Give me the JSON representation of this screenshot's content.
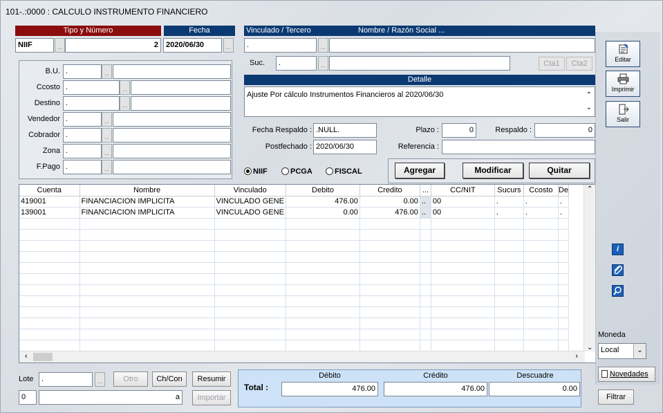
{
  "window": {
    "title": "101-.:0000 : CALCULO INSTRUMENTO FINANCIERO"
  },
  "doc": {
    "tipo_header": "Tipo y Número",
    "fecha_header": "Fecha",
    "tipo": "NIIF",
    "numero": "2",
    "fecha": "2020/06/30"
  },
  "vinculado": {
    "header_left": "Vinculado / Tercero",
    "header_right": "Nombre / Razón Social ...",
    "value": ".",
    "suc_label": "Suc.",
    "suc_value": ".",
    "cta1": "Cta1",
    "cta2": "Cta2"
  },
  "detalle": {
    "header": "Detalle",
    "text": "Ajuste Por cálculo Instrumentos Financieros al  2020/06/30"
  },
  "fields": [
    {
      "label": "B.U.",
      "value": "."
    },
    {
      "label": "Ccosto",
      "value": "."
    },
    {
      "label": "Destino",
      "value": "."
    },
    {
      "label": "Vendedor",
      "value": "."
    },
    {
      "label": "Cobrador",
      "value": "."
    },
    {
      "label": "Zona",
      "value": "."
    },
    {
      "label": "F.Pago",
      "value": "."
    }
  ],
  "respaldo": {
    "fecha_label": "Fecha Respaldo :",
    "fecha_value": ".NULL.",
    "plazo_label": "Plazo :",
    "plazo_value": "0",
    "respaldo_label": "Respaldo :",
    "respaldo_value": "0",
    "postf_label": "Postfechado :",
    "postf_value": "2020/06/30",
    "ref_label": "Referencia :",
    "ref_value": ""
  },
  "radios": [
    {
      "label": "NIIF",
      "checked": true
    },
    {
      "label": "PCGA",
      "checked": false
    },
    {
      "label": "FISCAL",
      "checked": false
    }
  ],
  "actions": {
    "agregar": "Agregar",
    "modificar": "Modificar",
    "quitar": "Quitar"
  },
  "side": {
    "editar": "Editar",
    "imprimir": "Imprimir",
    "salir": "Salir",
    "info_icon": "i",
    "moneda_label": "Moneda",
    "moneda_value": "Local",
    "novedades": "Novedades",
    "filtrar": "Filtrar"
  },
  "table": {
    "columns": [
      "Cuenta",
      "Nombre",
      "Vinculado",
      "Debito",
      "Credito",
      "...",
      "CC/NIT",
      "Sucurs",
      "Ccosto",
      "De"
    ],
    "rows": [
      [
        "419001",
        "FINANCIACION IMPLICITA",
        "VINCULADO GENE",
        "476.00",
        "0.00",
        "..",
        "00",
        ".",
        ".",
        "."
      ],
      [
        "139001",
        "FINANCIACION IMPLICITA",
        "VINCULADO GENE",
        "0.00",
        "476.00",
        "..",
        "00",
        ".",
        ".",
        "."
      ]
    ]
  },
  "bottom": {
    "lote_label": "Lote",
    "lote_value": ".",
    "otro": "Otro",
    "chcon": "Ch/Con",
    "resumir": "Resumir",
    "importar": "Importar",
    "zero": "0",
    "a": "a"
  },
  "totals": {
    "label": "Total :",
    "debito_h": "Débito",
    "credito_h": "Crédito",
    "descuadre_h": "Descuadre",
    "debito": "476.00",
    "credito": "476.00",
    "descuadre": "0.00"
  },
  "colors": {
    "red_header": "#8b0d0d",
    "blue_header": "#0b3a73"
  }
}
